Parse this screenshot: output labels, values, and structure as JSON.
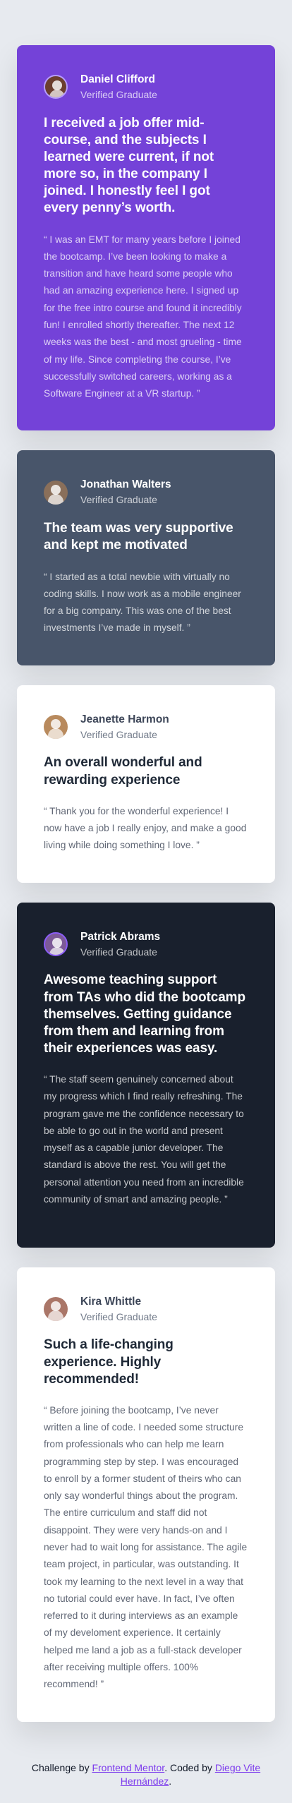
{
  "testimonials": [
    {
      "name": "Daniel Clifford",
      "role": "Verified Graduate",
      "headline": "I received a job offer mid-course, and the subjects I learned were current, if not more so, in the company I joined. I honestly feel I got every penny’s worth.",
      "quote": "“ I was an EMT for many years before I joined the bootcamp. I’ve been looking to make a transition and have heard some people who had an amazing experience here. I signed up for the free intro course and found it incredibly fun! I enrolled shortly thereafter. The next 12 weeks was the best - and most grueling - time of my life. Since completing the course, I’ve successfully switched careers, working as a Software Engineer at a VR startup. ”"
    },
    {
      "name": "Jonathan Walters",
      "role": "Verified Graduate",
      "headline": "The team was very supportive and kept me motivated",
      "quote": "“ I started as a total newbie with virtually no coding skills. I now work as a mobile engineer for a big company. This was one of the best investments I’ve made in myself. ”"
    },
    {
      "name": "Jeanette Harmon",
      "role": "Verified Graduate",
      "headline": "An overall wonderful and rewarding experience",
      "quote": "“ Thank you for the wonderful experience! I now have a job I really enjoy, and make a good living while doing something I love. ”"
    },
    {
      "name": "Patrick Abrams",
      "role": "Verified Graduate",
      "headline": "Awesome teaching support from TAs who did the bootcamp themselves. Getting guidance from them and learning from their experiences was easy.",
      "quote": "“ The staff seem genuinely concerned about my progress which I find really refreshing. The program gave me the confidence necessary to be able to go out in the world and present myself as a capable junior developer. The standard is above the rest. You will get the personal attention you need from an incredible community of smart and amazing people. ”"
    },
    {
      "name": "Kira Whittle",
      "role": "Verified Graduate",
      "headline": "Such a life-changing experience. Highly recommended!",
      "quote": "“ Before joining the bootcamp, I’ve never written a line of code. I needed some structure from professionals who can help me learn programming step by step. I was encouraged to enroll by a former student of theirs who can only say wonderful things about the program. The entire curriculum and staff did not disappoint. They were very hands-on and I never had to wait long for assistance. The agile team project, in particular, was outstanding. It took my learning to the next level in a way that no tutorial could ever have. In fact, I’ve often referred to it during interviews as an example of my develoment experience. It certainly helped me land a job as a full-stack developer after receiving multiple offers. 100% recommend! ”"
    }
  ],
  "footer": {
    "prefix": "Challenge by",
    "frontend_mentor": "Frontend Mentor",
    "middle": ". Coded by",
    "author": "Diego Vite Hernández",
    "suffix": "."
  }
}
